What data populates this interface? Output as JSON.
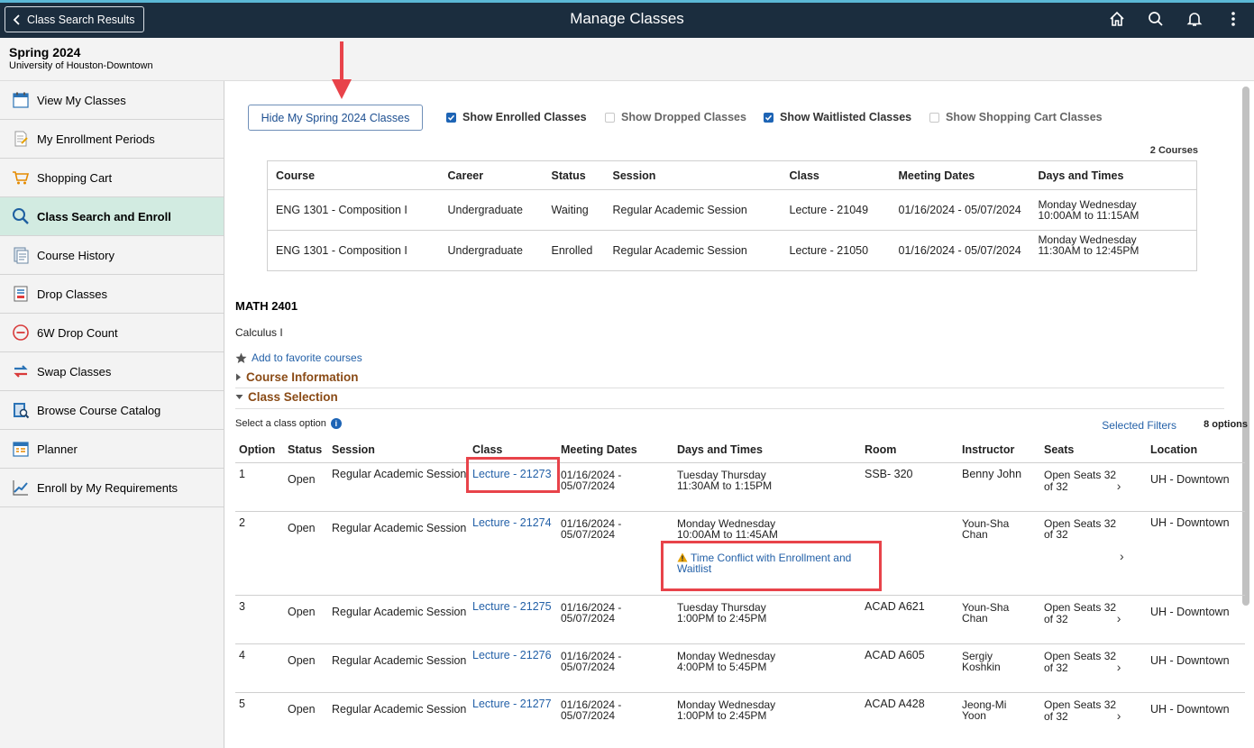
{
  "topbar": {
    "back_label": "Class Search Results",
    "title": "Manage Classes",
    "icons": [
      "home-icon",
      "search-icon",
      "bell-icon",
      "more-vertical-icon"
    ]
  },
  "term": {
    "name": "Spring 2024",
    "institution": "University of Houston-Downtown"
  },
  "sidebar": {
    "items": [
      {
        "label": "View My Classes",
        "icon": "calendar-icon"
      },
      {
        "label": "My Enrollment Periods",
        "icon": "document-icon"
      },
      {
        "label": "Shopping Cart",
        "icon": "cart-icon"
      },
      {
        "label": "Class Search and Enroll",
        "icon": "search-icon",
        "active": true
      },
      {
        "label": "Course History",
        "icon": "history-icon"
      },
      {
        "label": "Drop Classes",
        "icon": "drop-icon"
      },
      {
        "label": "6W Drop Count",
        "icon": "minus-circle-icon"
      },
      {
        "label": "Swap Classes",
        "icon": "swap-icon"
      },
      {
        "label": "Browse Course Catalog",
        "icon": "catalog-icon"
      },
      {
        "label": "Planner",
        "icon": "planner-icon"
      },
      {
        "label": "Enroll by My Requirements",
        "icon": "chart-line-icon"
      }
    ]
  },
  "filters": {
    "hide_button": "Hide My Spring 2024 Classes",
    "enrolled": "Show Enrolled Classes",
    "dropped": "Show Dropped Classes",
    "waitlisted": "Show Waitlisted Classes",
    "cart": "Show Shopping Cart Classes"
  },
  "enrolled_summary": {
    "count": "2 Courses",
    "headers": [
      "Course",
      "Career",
      "Status",
      "Session",
      "Class",
      "Meeting Dates",
      "Days and Times"
    ],
    "rows": [
      {
        "course": "ENG 1301 - Composition I",
        "career": "Undergraduate",
        "status": "Waiting",
        "session": "Regular Academic Session",
        "class": "Lecture - 21049",
        "dates": "01/16/2024 - 05/07/2024",
        "days": "Monday Wednesday",
        "times": "10:00AM to 11:15AM"
      },
      {
        "course": "ENG 1301 - Composition I",
        "career": "Undergraduate",
        "status": "Enrolled",
        "session": "Regular Academic Session",
        "class": "Lecture - 21050",
        "dates": "01/16/2024 - 05/07/2024",
        "days": "Monday Wednesday",
        "times": "11:30AM to 12:45PM"
      }
    ]
  },
  "course": {
    "code": "MATH 2401",
    "title": "Calculus I",
    "favorite": "Add to favorite courses",
    "info_section": "Course Information",
    "selection_section": "Class Selection",
    "select_label": "Select a class option",
    "selected_filters": "Selected Filters",
    "options_count": "8 options"
  },
  "class_table": {
    "headers": [
      "Option",
      "Status",
      "Session",
      "Class",
      "Meeting Dates",
      "Days and Times",
      "Room",
      "Instructor",
      "Seats",
      "Location"
    ],
    "rows": [
      {
        "option": "1",
        "status": "Open",
        "session": "Regular Academic Session",
        "class": "Lecture - 21273",
        "date1": "01/16/2024 -",
        "date2": "05/07/2024",
        "days": "Tuesday Thursday",
        "times": "11:30AM to 1:15PM",
        "conflict": "",
        "room": "SSB- 320",
        "instructor1": "Benny John",
        "instructor2": "",
        "seats1": "Open Seats 32",
        "seats2": "of 32",
        "location": "UH - Downtown"
      },
      {
        "option": "2",
        "status": "Open",
        "session": "Regular Academic Session",
        "class": "Lecture - 21274",
        "date1": "01/16/2024 -",
        "date2": "05/07/2024",
        "days": "Monday Wednesday",
        "times": "10:00AM to 11:45AM",
        "conflict": "Time Conflict with Enrollment and",
        "conflict2": "Waitlist",
        "room": "",
        "instructor1": "Youn-Sha",
        "instructor2": "Chan",
        "seats1": "Open Seats 32",
        "seats2": "of 32",
        "location": "UH - Downtown"
      },
      {
        "option": "3",
        "status": "Open",
        "session": "Regular Academic Session",
        "class": "Lecture - 21275",
        "date1": "01/16/2024 -",
        "date2": "05/07/2024",
        "days": "Tuesday Thursday",
        "times": "1:00PM to 2:45PM",
        "conflict": "",
        "room": "ACAD A621",
        "instructor1": "Youn-Sha",
        "instructor2": "Chan",
        "seats1": "Open Seats 32",
        "seats2": "of 32",
        "location": "UH - Downtown"
      },
      {
        "option": "4",
        "status": "Open",
        "session": "Regular Academic Session",
        "class": "Lecture - 21276",
        "date1": "01/16/2024 -",
        "date2": "05/07/2024",
        "days": "Monday Wednesday",
        "times": "4:00PM to 5:45PM",
        "conflict": "",
        "room": "ACAD A605",
        "instructor1": "Sergiy",
        "instructor2": "Koshkin",
        "seats1": "Open Seats 32",
        "seats2": "of 32",
        "location": "UH - Downtown"
      },
      {
        "option": "5",
        "status": "Open",
        "session": "Regular Academic Session",
        "class": "Lecture - 21277",
        "date1": "01/16/2024 -",
        "date2": "05/07/2024",
        "days": "Monday Wednesday",
        "times": "1:00PM to 2:45PM",
        "conflict": "",
        "room": "ACAD A428",
        "instructor1": "Jeong-Mi",
        "instructor2": "Yoon",
        "seats1": "Open Seats 32",
        "seats2": "of 32",
        "location": "UH - Downtown"
      }
    ]
  },
  "colors": {
    "topbar": "#1b2d3e",
    "accent_link": "#2461a8",
    "section": "#8a4b16",
    "highlight": "#e8434a",
    "active_nav": "#d2ebe1"
  }
}
